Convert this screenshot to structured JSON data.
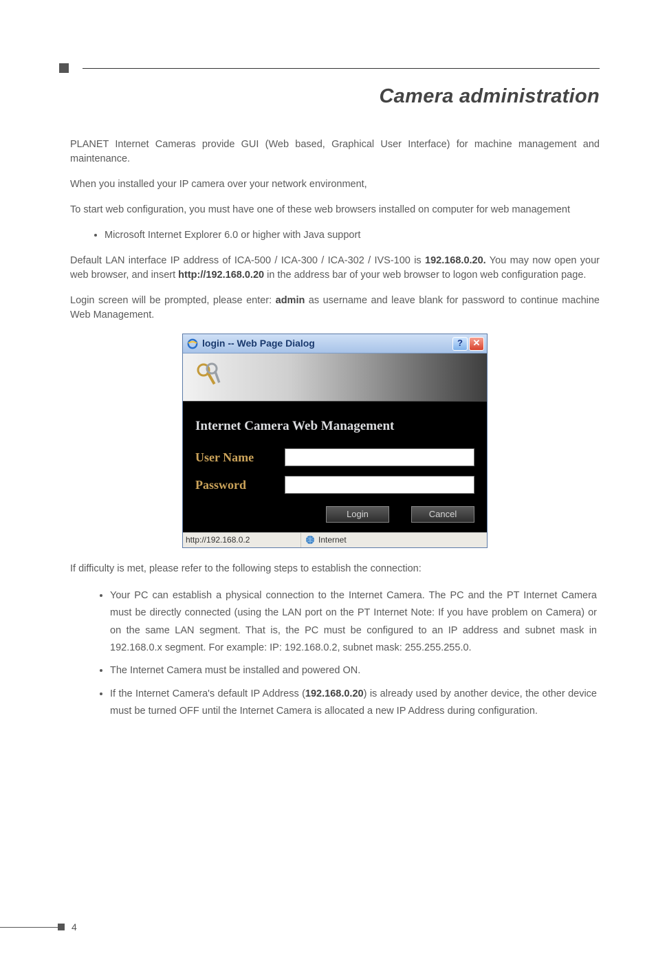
{
  "title": "Camera administration",
  "para1": "PLANET Internet Cameras provide GUI (Web based, Graphical User Interface) for machine management and maintenance.",
  "para2": "When you installed your IP camera over your network environment,",
  "para3": "To start web configuration, you must have one of these web browsers installed on computer for web management",
  "bullet1": "Microsoft Internet Explorer 6.0 or higher with Java support",
  "para4a": "Default LAN interface IP address of ICA-500 / ICA-300 / ICA-302 / IVS-100 is ",
  "para4b": "192.168.0.20.",
  "para4c": " You may now open your web browser, and insert ",
  "para4d": "http://192.168.0.20",
  "para4e": " in the address bar of your web browser to logon web configuration page.",
  "para5a": "Login screen will be prompted, please enter: ",
  "para5b": "admin",
  "para5c": " as username and leave blank for password to continue machine Web Management.",
  "dialog": {
    "title": "login -- Web Page Dialog",
    "help": "?",
    "close": "✕",
    "heading": "Internet Camera Web Management",
    "userLabel": "User Name",
    "passLabel": "Password",
    "userValue": "",
    "passValue": "",
    "loginBtn": "Login",
    "cancelBtn": "Cancel",
    "statusUrl": "http://192.168.0.2",
    "statusZone": "Internet"
  },
  "para6": "If difficulty is met, please refer to the following steps to establish the connection:",
  "trouble": {
    "item1": "Your PC can establish a physical connection to the Internet Camera. The PC and the PT Internet Camera must be directly connected (using the LAN port on the PT Internet Note: If you have problem on Camera) or on the same LAN segment. That is, the PC must be configured to an IP address and subnet mask in 192.168.0.x segment. For example: IP: 192.168.0.2, subnet mask: 255.255.255.0.",
    "item2": "The Internet Camera must be installed and powered ON.",
    "item3a": "If the Internet Camera's default IP Address (",
    "item3b": "192.168.0.20",
    "item3c": ") is already used by another device, the other device must be turned OFF until the Internet Camera is allocated a new IP Address during configuration."
  },
  "pageNumber": "4"
}
